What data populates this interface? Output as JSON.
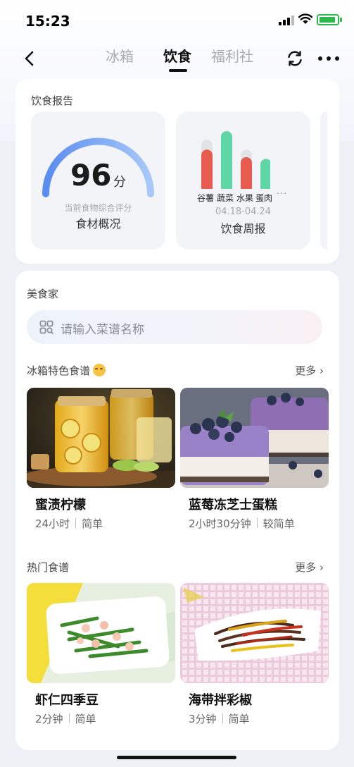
{
  "status_bar": {
    "time": "15:23"
  },
  "nav": {
    "tabs": [
      {
        "label": "冰箱",
        "active": false
      },
      {
        "label": "饮食",
        "active": true
      },
      {
        "label": "福利社",
        "active": false
      }
    ]
  },
  "report": {
    "section_title": "饮食报告",
    "score": {
      "value": "96",
      "unit": "分",
      "fraction": 0.96,
      "subtitle": "当前食物综合评分",
      "title": "食材概况"
    },
    "weekly": {
      "categories": [
        "谷薯",
        "蔬菜",
        "水果",
        "蛋肉"
      ],
      "more": "···",
      "date_range": "04.18-04.24",
      "title": "饮食周报"
    }
  },
  "chart_data": {
    "type": "bar",
    "categories": [
      "谷薯",
      "蔬菜",
      "水果",
      "蛋肉"
    ],
    "series": [
      {
        "values": [
          0.68,
          1.0,
          0.55,
          0.52
        ]
      }
    ],
    "target": [
      0.85,
      1.0,
      0.68,
      0.52
    ],
    "colors": [
      "#e85b4f",
      "#5fd6a6",
      "#e85b4f",
      "#5fd6a6"
    ]
  },
  "food": {
    "section_title": "美食家",
    "search_placeholder": "请输入菜谱名称",
    "featured": {
      "title": "冰箱特色食谱",
      "more": "更多 ›",
      "recipes": [
        {
          "name": "蜜渍柠檬",
          "time": "24小时",
          "difficulty": "简单"
        },
        {
          "name": "蓝莓冻芝士蛋糕",
          "time": "2小时30分钟",
          "difficulty": "较简单"
        }
      ]
    },
    "popular": {
      "title": "热门食谱",
      "more": "更多 ›",
      "recipes": [
        {
          "name": "虾仁四季豆",
          "time": "2分钟",
          "difficulty": "简单"
        },
        {
          "name": "海带拌彩椒",
          "time": "3分钟",
          "difficulty": "简单"
        }
      ]
    }
  },
  "colors": {
    "gauge_start": "#5b8def",
    "gauge_end": "#a8c8f8",
    "accent": "#111111"
  }
}
